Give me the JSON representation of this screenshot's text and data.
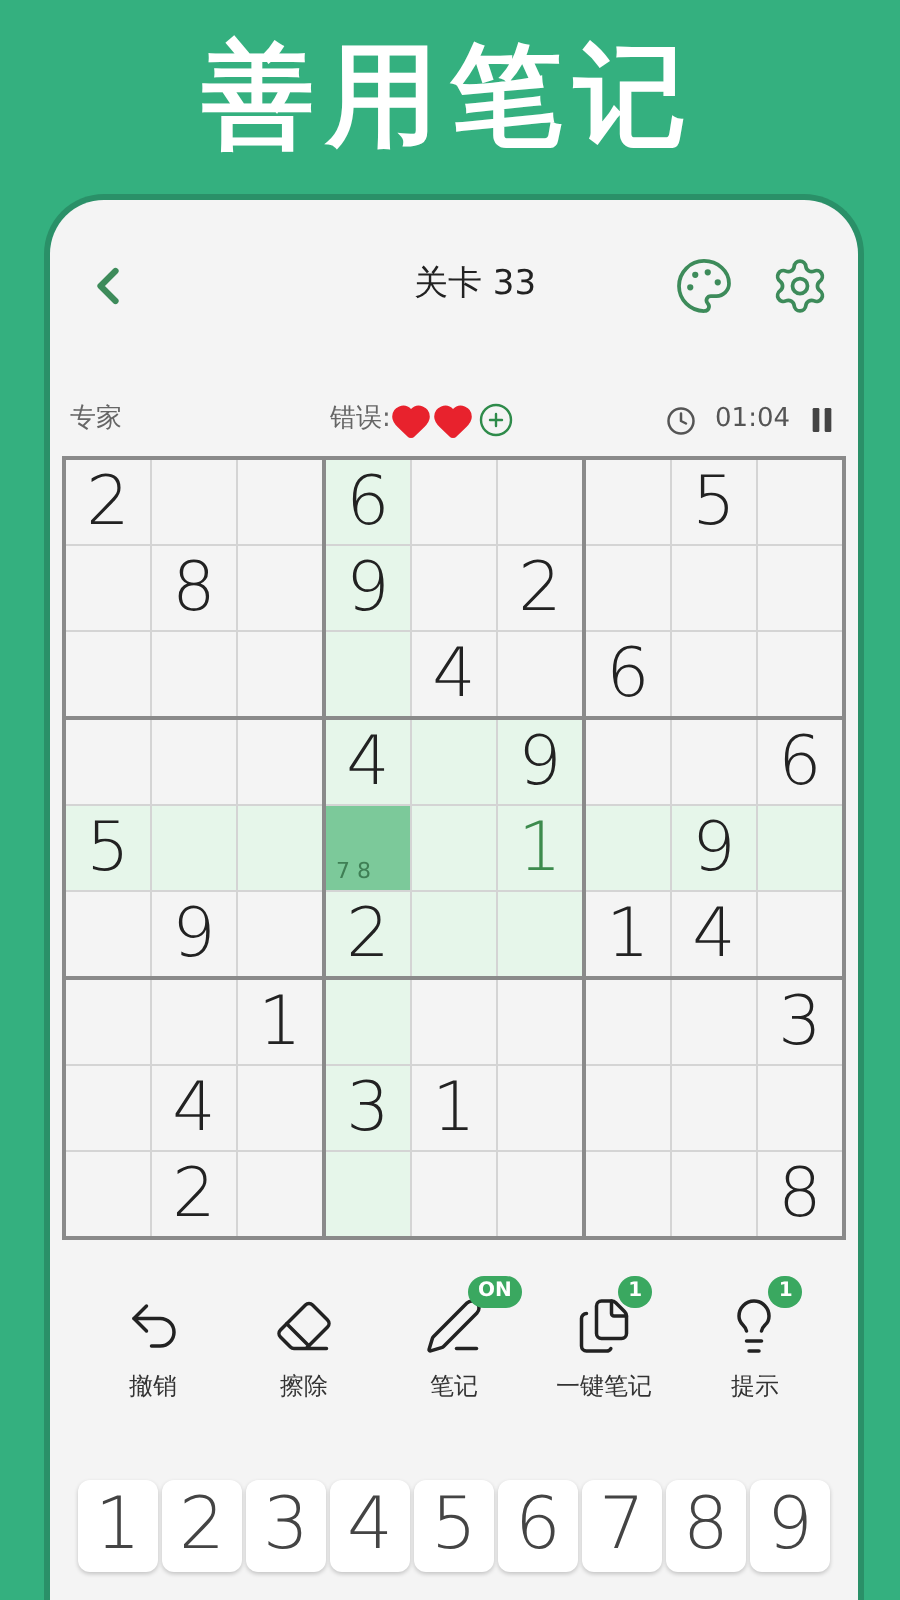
{
  "headline": "善用笔记",
  "header": {
    "title": "关卡 33"
  },
  "status": {
    "difficulty": "专家",
    "mistakes_label": "错误:",
    "lives": [
      {
        "filled": true
      },
      {
        "filled": true
      }
    ],
    "time": "01:04"
  },
  "board": {
    "rows": [
      [
        {
          "kind": "given",
          "value": "2",
          "selected": false
        },
        {
          "kind": "empty",
          "selected": false
        },
        {
          "kind": "empty",
          "selected": false
        },
        {
          "kind": "given",
          "value": "6",
          "selected": false
        },
        {
          "kind": "empty",
          "selected": false
        },
        {
          "kind": "empty",
          "selected": false
        },
        {
          "kind": "empty",
          "selected": false
        },
        {
          "kind": "given",
          "value": "5",
          "selected": false
        },
        {
          "kind": "empty",
          "selected": false
        }
      ],
      [
        {
          "kind": "empty",
          "selected": false
        },
        {
          "kind": "given",
          "value": "8",
          "selected": false
        },
        {
          "kind": "empty",
          "selected": false
        },
        {
          "kind": "given",
          "value": "9",
          "selected": false
        },
        {
          "kind": "empty",
          "selected": false
        },
        {
          "kind": "given",
          "value": "2",
          "selected": false
        },
        {
          "kind": "empty",
          "selected": false
        },
        {
          "kind": "empty",
          "selected": false
        },
        {
          "kind": "empty",
          "selected": false
        }
      ],
      [
        {
          "kind": "empty",
          "selected": false
        },
        {
          "kind": "empty",
          "selected": false
        },
        {
          "kind": "empty",
          "selected": false
        },
        {
          "kind": "empty",
          "selected": false
        },
        {
          "kind": "given",
          "value": "4",
          "selected": false
        },
        {
          "kind": "empty",
          "selected": false
        },
        {
          "kind": "given",
          "value": "6",
          "selected": false
        },
        {
          "kind": "empty",
          "selected": false
        },
        {
          "kind": "empty",
          "selected": false
        }
      ],
      [
        {
          "kind": "empty",
          "selected": false
        },
        {
          "kind": "empty",
          "selected": false
        },
        {
          "kind": "empty",
          "selected": false
        },
        {
          "kind": "given",
          "value": "4",
          "selected": false
        },
        {
          "kind": "empty",
          "selected": false
        },
        {
          "kind": "given",
          "value": "9",
          "selected": false
        },
        {
          "kind": "empty",
          "selected": false
        },
        {
          "kind": "empty",
          "selected": false
        },
        {
          "kind": "given",
          "value": "6",
          "selected": false
        }
      ],
      [
        {
          "kind": "given",
          "value": "5",
          "selected": false
        },
        {
          "kind": "empty",
          "selected": false
        },
        {
          "kind": "empty",
          "selected": false
        },
        {
          "kind": "notes",
          "value": "7 8",
          "selected": true
        },
        {
          "kind": "empty",
          "selected": false
        },
        {
          "kind": "entered",
          "value": "1",
          "selected": false
        },
        {
          "kind": "empty",
          "selected": false
        },
        {
          "kind": "given",
          "value": "9",
          "selected": false
        },
        {
          "kind": "empty",
          "selected": false
        }
      ],
      [
        {
          "kind": "empty",
          "selected": false
        },
        {
          "kind": "given",
          "value": "9",
          "selected": false
        },
        {
          "kind": "empty",
          "selected": false
        },
        {
          "kind": "given",
          "value": "2",
          "selected": false
        },
        {
          "kind": "empty",
          "selected": false
        },
        {
          "kind": "empty",
          "selected": false
        },
        {
          "kind": "given",
          "value": "1",
          "selected": false
        },
        {
          "kind": "given",
          "value": "4",
          "selected": false
        },
        {
          "kind": "empty",
          "selected": false
        }
      ],
      [
        {
          "kind": "empty",
          "selected": false
        },
        {
          "kind": "empty",
          "selected": false
        },
        {
          "kind": "given",
          "value": "1",
          "selected": false
        },
        {
          "kind": "empty",
          "selected": false
        },
        {
          "kind": "empty",
          "selected": false
        },
        {
          "kind": "empty",
          "selected": false
        },
        {
          "kind": "empty",
          "selected": false
        },
        {
          "kind": "empty",
          "selected": false
        },
        {
          "kind": "given",
          "value": "3",
          "selected": false
        }
      ],
      [
        {
          "kind": "empty",
          "selected": false
        },
        {
          "kind": "given",
          "value": "4",
          "selected": false
        },
        {
          "kind": "empty",
          "selected": false
        },
        {
          "kind": "given",
          "value": "3",
          "selected": false
        },
        {
          "kind": "given",
          "value": "1",
          "selected": false
        },
        {
          "kind": "empty",
          "selected": false
        },
        {
          "kind": "empty",
          "selected": false
        },
        {
          "kind": "empty",
          "selected": false
        },
        {
          "kind": "empty",
          "selected": false
        }
      ],
      [
        {
          "kind": "empty",
          "selected": false
        },
        {
          "kind": "given",
          "value": "2",
          "selected": false
        },
        {
          "kind": "empty",
          "selected": false
        },
        {
          "kind": "empty",
          "selected": false
        },
        {
          "kind": "empty",
          "selected": false
        },
        {
          "kind": "empty",
          "selected": false
        },
        {
          "kind": "empty",
          "selected": false
        },
        {
          "kind": "empty",
          "selected": false
        },
        {
          "kind": "given",
          "value": "8",
          "selected": false
        }
      ]
    ]
  },
  "tools": [
    {
      "kind": "undo",
      "label": "撤销"
    },
    {
      "kind": "erase",
      "label": "擦除"
    },
    {
      "kind": "notes",
      "label": "笔记",
      "badge": "ON"
    },
    {
      "kind": "autonotes",
      "label": "一键笔记",
      "badge": "1"
    },
    {
      "kind": "hint",
      "label": "提示",
      "badge": "1"
    }
  ],
  "keypad": [
    "1",
    "2",
    "3",
    "4",
    "5",
    "6",
    "7",
    "8",
    "9"
  ]
}
